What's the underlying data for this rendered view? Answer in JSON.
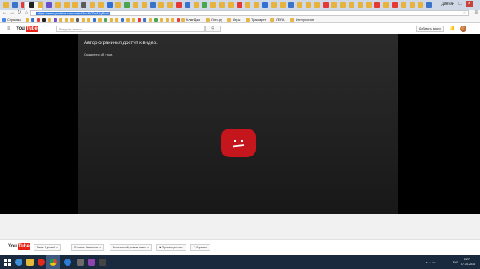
{
  "browser": {
    "user_label": "Данна",
    "tab_colors": [
      "#e8b33c",
      "#3b73c8",
      "#e53935",
      "#222222",
      "#e8b33c",
      "#6a4fc8",
      "#e8b33c",
      "#e8b33c",
      "#e8b33c",
      "#5c5c5c",
      "#e8b33c",
      "#e8b33c",
      "#2f6fd6",
      "#e8b33c",
      "#4aa64e",
      "#e8b33c",
      "#e8b33c",
      "#3b73c8",
      "#e8b33c",
      "#e8b33c",
      "#e53935",
      "#3b73c8",
      "#e8b33c",
      "#4aa64e",
      "#e8b33c",
      "#e8b33c",
      "#e8b33c",
      "#e53935",
      "#e8b33c",
      "#e8b33c",
      "#2f6fd6",
      "#e8b33c",
      "#e8b33c",
      "#3b73c8",
      "#e8b33c",
      "#e8b33c",
      "#e8b33c",
      "#e53935",
      "#e8b33c",
      "#e8b33c",
      "#e8b33c",
      "#e8b33c",
      "#e8b33c",
      "#e53935",
      "#e8b33c",
      "#e53935",
      "#e8b33c",
      "#e8b33c",
      "#e8b33c",
      "#3b73c8"
    ],
    "url": "https://www.youtube.com/watch?v=8eThxF1gBvM",
    "bookmarks": {
      "first_label": "Сервисы",
      "folders": [
        "КлмнДжо",
        "Лото.ру",
        "Игры",
        "Трафарет",
        "ЛЕРА",
        "Интересное"
      ]
    }
  },
  "youtube": {
    "logo_you": "You",
    "logo_tube": "Tube",
    "search_placeholder": "Введите запрос",
    "upload_label": "Добавить видео",
    "error_title": "Автор ограничил доступ к видео.",
    "error_subtitle": "Сожалеем об этом."
  },
  "footer": {
    "logo_you": "You",
    "logo_tube": "Tube",
    "language": "Язык: Русский",
    "country": "Страна: Казахстан",
    "safe_mode": "Безопасный режим: выкл.",
    "history": "Просмотренные",
    "help": "Справка"
  },
  "taskbar": {
    "lang": "РУС",
    "time": "2:27",
    "date": "07.10.2016"
  },
  "colors": {
    "youtube_red": "#e62117",
    "sad_tv_red": "#c4161c",
    "taskbar": "#1a2a3e"
  }
}
